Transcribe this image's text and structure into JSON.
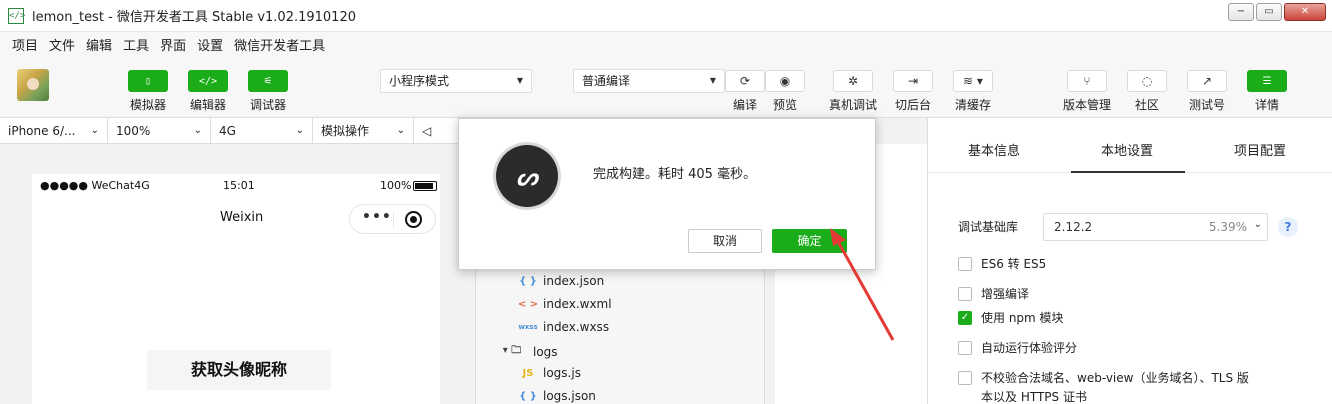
{
  "window": {
    "title": "lemon_test - 微信开发者工具 Stable v1.02.1910120",
    "app_icon": "</>",
    "controls": [
      "−",
      "▭",
      "✕"
    ]
  },
  "menu": [
    "项目",
    "文件",
    "编辑",
    "工具",
    "界面",
    "设置",
    "微信开发者工具"
  ],
  "toolbar": {
    "simulator": "模拟器",
    "editor": "编辑器",
    "debugger": "调试器",
    "mode_select": "小程序模式",
    "compile_select": "普通编译",
    "compile": "编译",
    "preview": "预览",
    "device_debug": "真机调试",
    "background": "切后台",
    "clear_cache": "清缓存",
    "version": "版本管理",
    "community": "社区",
    "test_account": "测试号",
    "details": "详情"
  },
  "devbar": {
    "device": "iPhone 6/...",
    "zoom": "100%",
    "network": "4G",
    "operation": "模拟操作"
  },
  "phone": {
    "carrier": "●●●●● WeChat4G",
    "time": "15:01",
    "battery": "100%",
    "nav_title": "Weixin",
    "capsule_dots": "•••",
    "button": "获取头像昵称"
  },
  "files": [
    {
      "name": "index.json",
      "icon": "{ }",
      "type": "json"
    },
    {
      "name": "index.wxml",
      "icon": "< >",
      "type": "wxml"
    },
    {
      "name": "index.wxss",
      "icon": "wxss",
      "type": "wxss"
    },
    {
      "name": "logs",
      "icon": "▾ 🗀",
      "type": "folder"
    },
    {
      "name": "logs.js",
      "icon": "JS",
      "type": "js"
    },
    {
      "name": "logs.json",
      "icon": "{ }",
      "type": "json"
    }
  ],
  "right_panel": {
    "tabs": [
      "基本信息",
      "本地设置",
      "项目配置"
    ],
    "active_tab": "本地设置",
    "lib_label": "调试基础库",
    "lib_version": "2.12.2",
    "lib_percent": "5.39%",
    "help": "?",
    "options": [
      {
        "label": "ES6 转 ES5",
        "checked": false
      },
      {
        "label": "增强编译",
        "checked": false
      },
      {
        "label": "使用 npm 模块",
        "checked": true
      },
      {
        "label": "自动运行体验评分",
        "checked": false
      },
      {
        "label": "不校验合法域名、web-view（业务域名）、TLS 版",
        "checked": false
      }
    ],
    "option_cont": "本以及 HTTPS 证书"
  },
  "modal": {
    "message": "完成构建。耗时 405 毫秒。",
    "cancel": "取消",
    "ok": "确定"
  },
  "colors": {
    "green": "#1aad19",
    "annotation_arrow": "#e53935"
  }
}
